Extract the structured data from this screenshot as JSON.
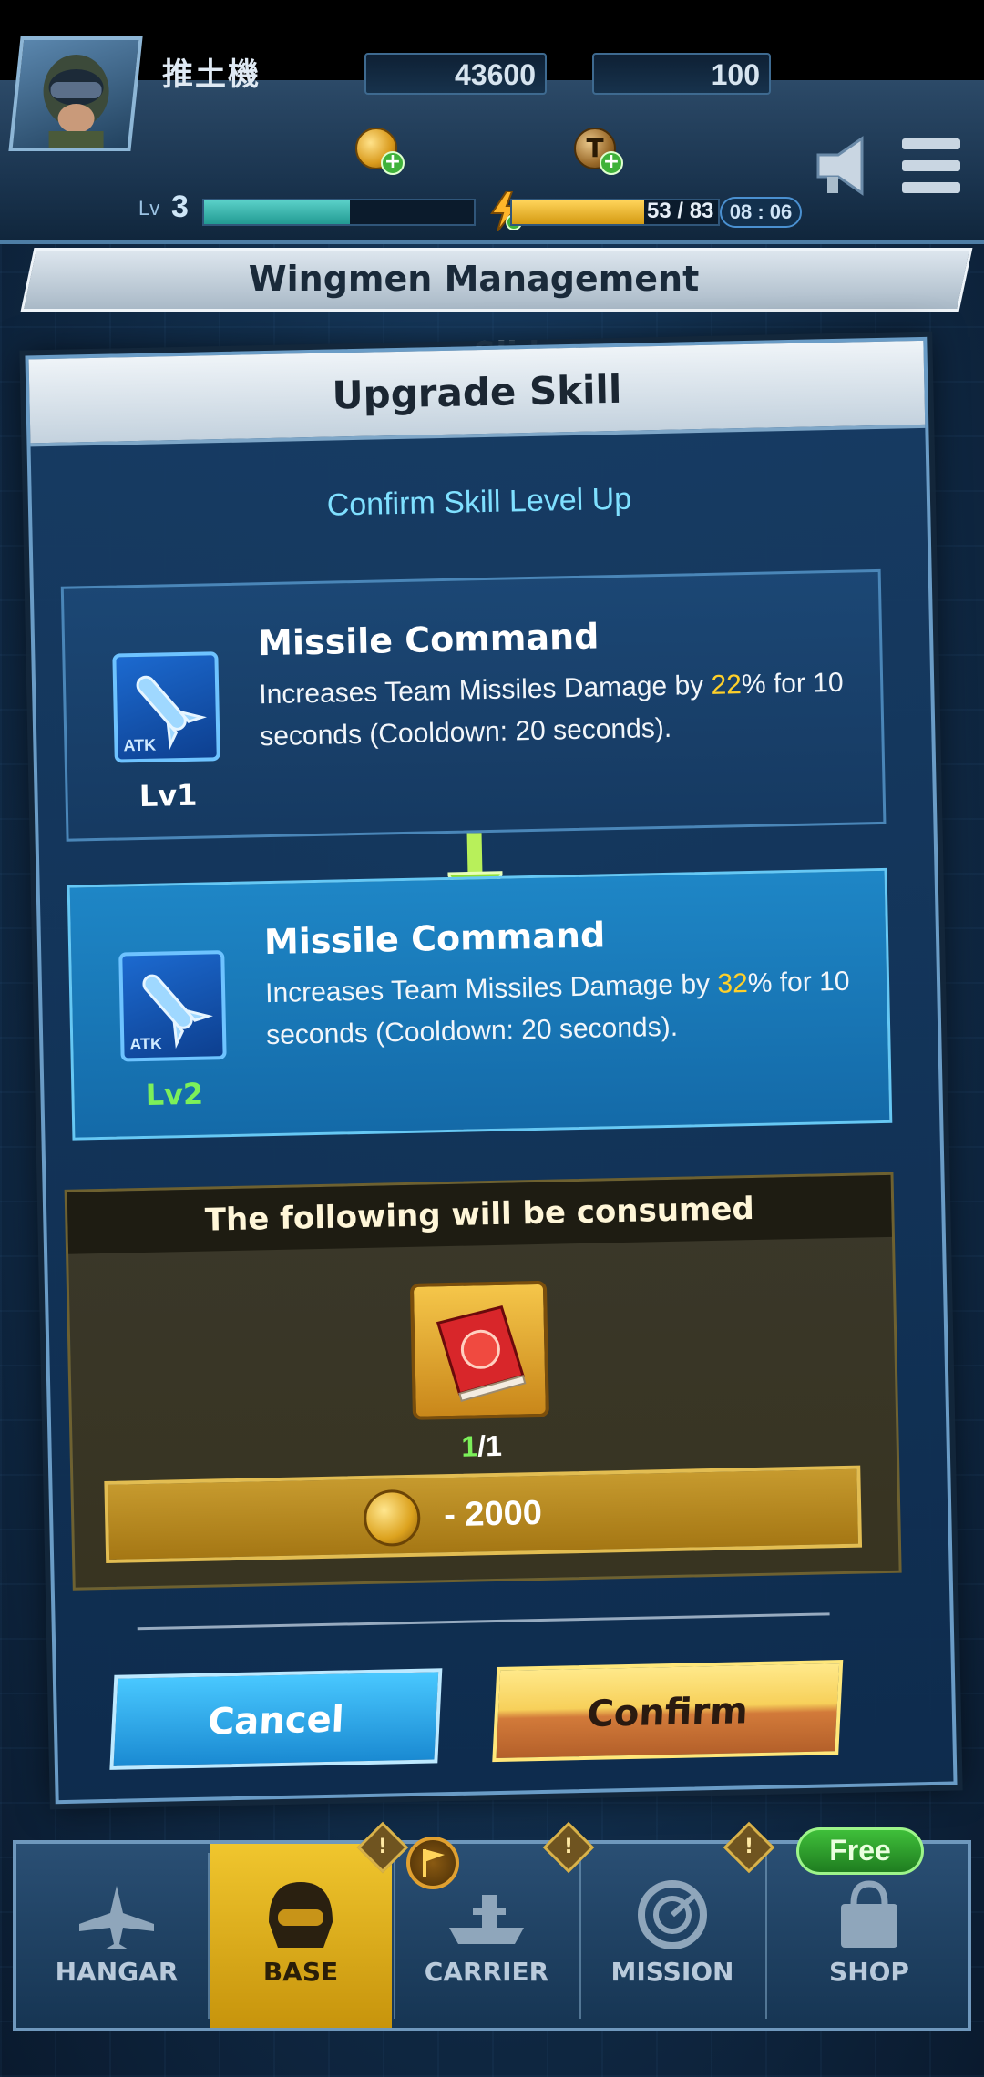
{
  "hud": {
    "player_name": "推土機",
    "gold": "43600",
    "tokens": "100",
    "level_prefix": "Lv",
    "level": "3",
    "xp_fraction": 0.54,
    "energy": "53 / 83",
    "energy_fraction": 0.64,
    "timer": "08 : 06",
    "icons": [
      "avatar",
      "gold-coin-icon",
      "token-icon",
      "bolt-icon",
      "megaphone-icon",
      "menu-icon"
    ]
  },
  "page_title": "Wingmen Management",
  "background_peek": "Slider",
  "modal": {
    "title": "Upgrade Skill",
    "subtitle": "Confirm Skill Level Up",
    "current": {
      "name": "Missile Command",
      "desc_before": "Increases Team Missiles Damage by ",
      "value": "22",
      "desc_after": "% for 10 seconds (Cooldown: 20 seconds).",
      "level": "Lv1",
      "icon_tag": "ATK"
    },
    "next": {
      "name": "Missile Command",
      "desc_before": "Increases Team Missiles Damage by ",
      "value": "32",
      "desc_after": "% for 10 seconds (Cooldown: 20 seconds).",
      "level": "Lv2",
      "icon_tag": "ATK"
    },
    "consume": {
      "title": "The following will be consumed",
      "item_have": "1",
      "item_need": "/1",
      "cost": "- 2000"
    },
    "cancel_label": "Cancel",
    "confirm_label": "Confirm"
  },
  "nav": {
    "items": [
      {
        "label": "HANGAR",
        "icon": "plane-icon"
      },
      {
        "label": "BASE",
        "icon": "helmet-icon",
        "active": true
      },
      {
        "label": "CARRIER",
        "icon": "carrier-icon"
      },
      {
        "label": "MISSION",
        "icon": "radar-icon"
      },
      {
        "label": "SHOP",
        "icon": "shopping-bag-icon"
      }
    ],
    "alert_mark": "!",
    "free_badge": "Free"
  },
  "colors": {
    "highlight": "#ffd02a",
    "next_level": "#7cf05a",
    "active_tab": "#f0c62e",
    "confirm": "#f7d05a",
    "cancel": "#49c8ff"
  }
}
